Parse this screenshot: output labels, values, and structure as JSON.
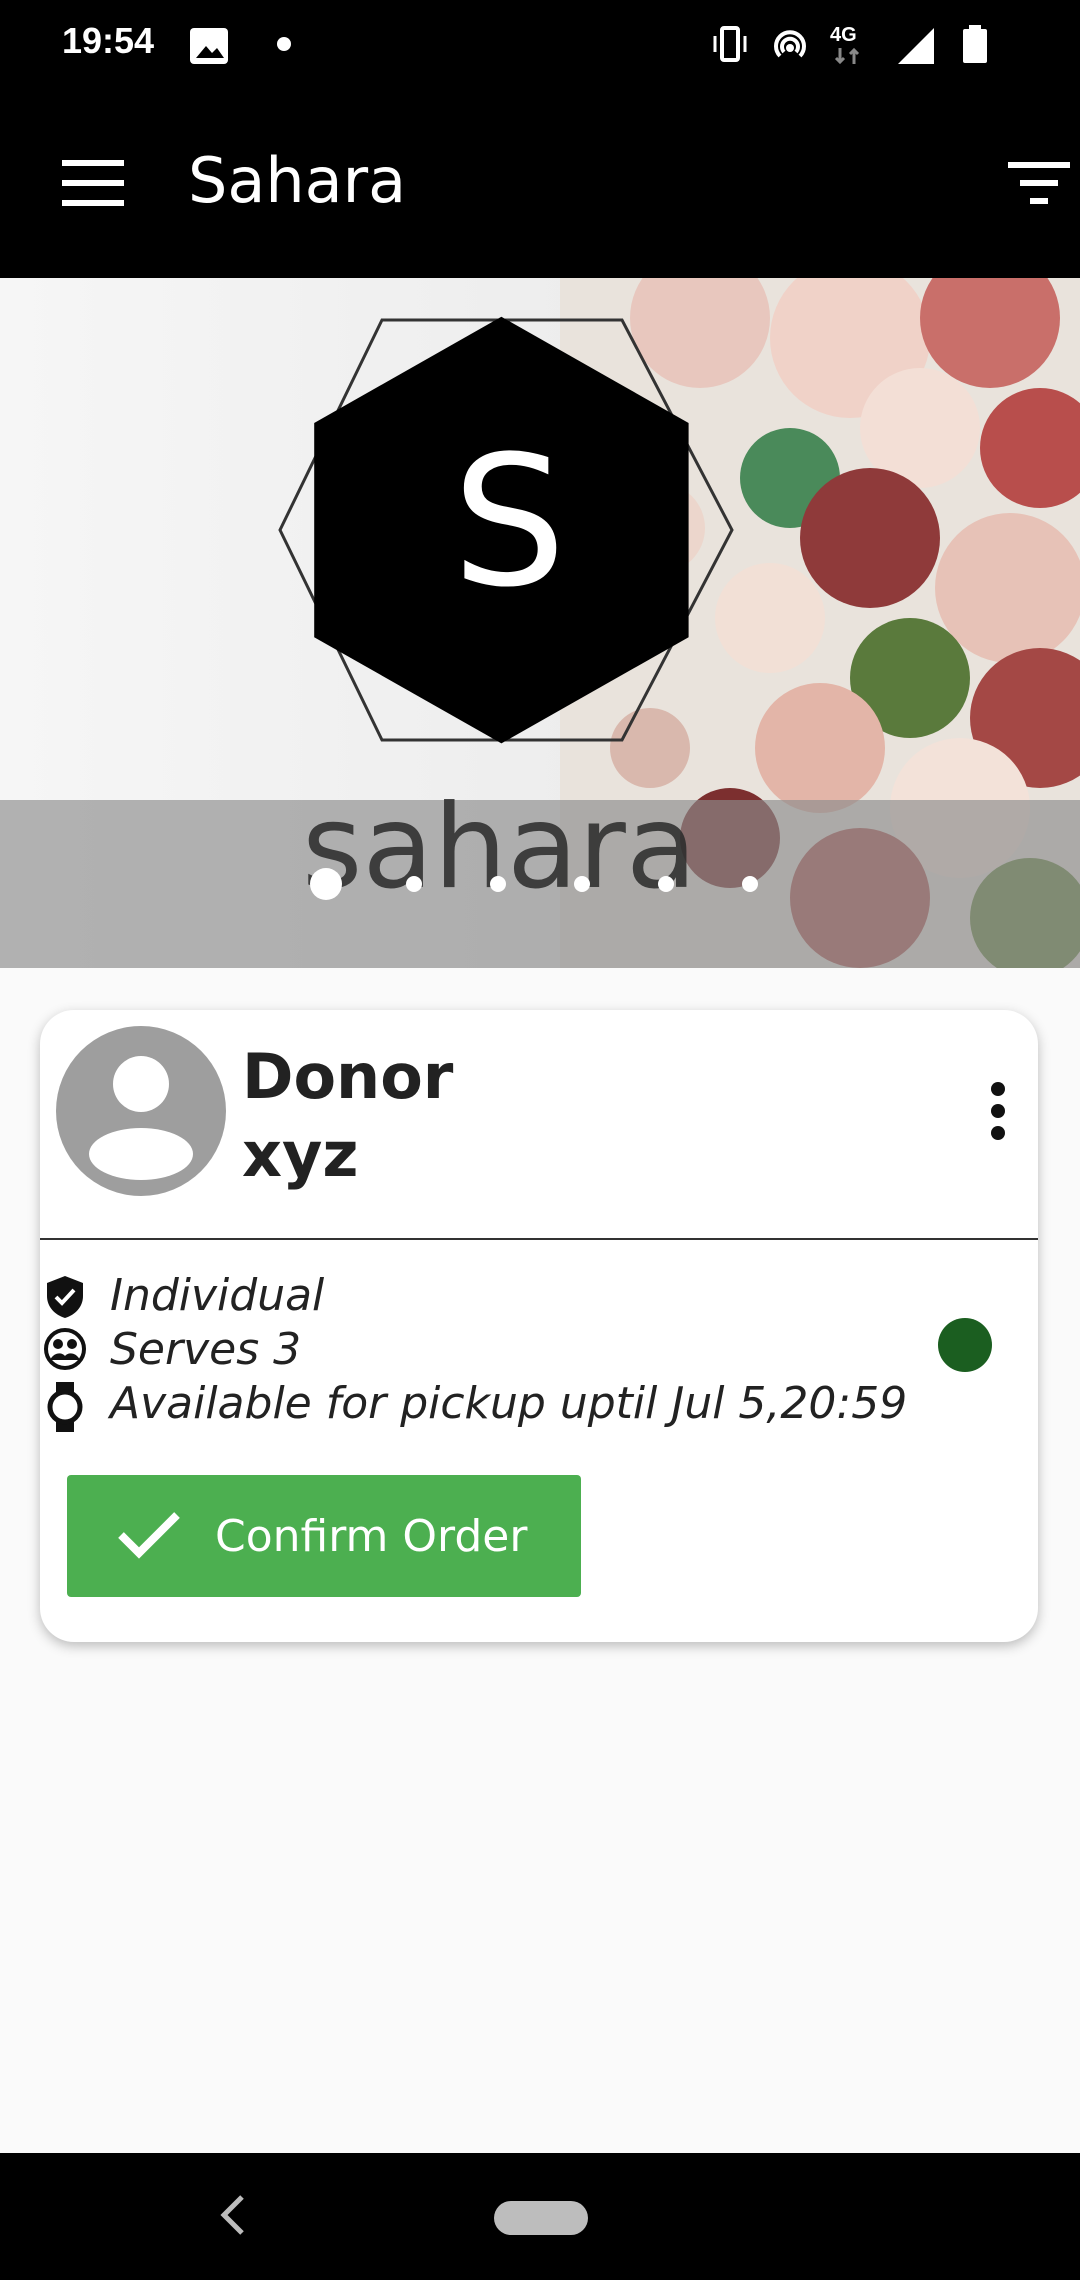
{
  "status_bar": {
    "time": "19:54",
    "left_icons": [
      "image-icon",
      "dot-icon"
    ],
    "right_icons": [
      "vibrate-icon",
      "hotspot-icon",
      "4g-icon",
      "signal-icon",
      "battery-icon"
    ],
    "network_label": "4G"
  },
  "app_bar": {
    "title": "Sahara",
    "menu_icon": "menu-icon",
    "filter_icon": "filter-icon"
  },
  "banner": {
    "logo_letter": "S",
    "logo_word": "sahara",
    "slide_count": 6,
    "active_slide": 1
  },
  "card": {
    "donor_name_line1": "Donor",
    "donor_name_line2": "xyz",
    "type": "Individual",
    "serves": "Serves 3",
    "availability": "Available for pickup uptil Jul 5,20:59",
    "status_color": "#1b5e20",
    "confirm_label": "Confirm Order"
  },
  "colors": {
    "app_bar": "#000000",
    "confirm_button": "#4caf50",
    "status_dot": "#1b5e20"
  }
}
